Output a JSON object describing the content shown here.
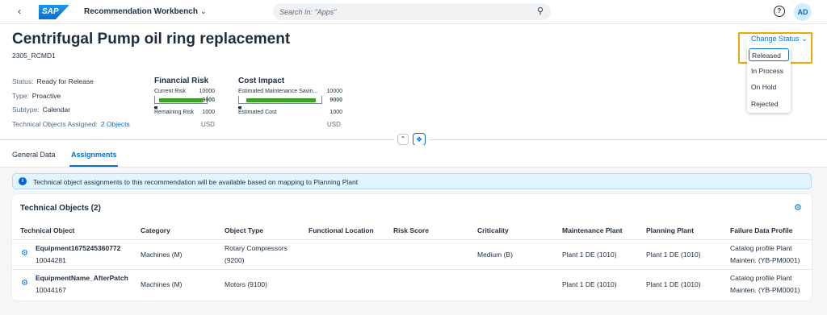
{
  "shell": {
    "logo_text": "SAP",
    "app_title": "Recommendation Workbench",
    "search_placeholder": "Search In: \"Apps\"",
    "user_initials": "AD"
  },
  "header": {
    "title": "Centrifugal Pump oil ring replacement",
    "subtitle": "2305_RCMD1",
    "status_label": "Status:",
    "status_value": "Ready for Release",
    "type_label": "Type:",
    "type_value": "Proactive",
    "subtype_label": "Subtype:",
    "subtype_value": "Calendar",
    "tech_objects_label": "Technical Objects Assigned:",
    "tech_objects_value": "2 Objects"
  },
  "financial_risk": {
    "title": "Financial Risk",
    "current_label": "Current Risk",
    "current_max": "10000",
    "current_value": "9000",
    "current_fraction": 0.9,
    "remaining_label": "Remaining Risk",
    "remaining_value": "1000",
    "unit": "USD"
  },
  "cost_impact": {
    "title": "Cost Impact",
    "savings_label": "Estimated Maintenance Savin...",
    "savings_max": "10000",
    "savings_value": "9000",
    "savings_fraction": 0.9,
    "cost_label": "Estimated Cost",
    "cost_value": "1000",
    "unit": "USD"
  },
  "change_status": {
    "label": "Change Status",
    "options": [
      "Released",
      "In Process",
      "On Hold",
      "Rejected"
    ],
    "highlight_color": "#e9a900"
  },
  "tabs": [
    "General Data",
    "Assignments"
  ],
  "info_message": "Technical object assignments to this recommendation will be available based on mapping to Planning Plant",
  "table": {
    "title": "Technical Objects (2)",
    "columns": [
      "Technical Object",
      "Category",
      "Object Type",
      "Functional Location",
      "Risk Score",
      "Criticality",
      "Maintenance Plant",
      "Planning Plant",
      "Failure Data Profile"
    ],
    "rows": [
      {
        "name": "Equipment1675245360772",
        "id": "10044281",
        "category": "Machines (M)",
        "object_type_1": "Rotary Compressors",
        "object_type_2": "(9200)",
        "criticality": "Medium (B)",
        "maintenance_plant": "Plant 1 DE (1010)",
        "planning_plant": "Plant 1 DE (1010)",
        "profile_1": "Catalog profile Plant",
        "profile_2": "Mainten. (YB-PM0001)"
      },
      {
        "name": "EquipmentName_AfterPatch",
        "id": "10044167",
        "category": "Machines (M)",
        "object_type_1": "Motors (9100)",
        "object_type_2": "",
        "criticality": "",
        "maintenance_plant": "Plant 1 DE (1010)",
        "planning_plant": "Plant 1 DE (1010)",
        "profile_1": "Catalog profile Plant",
        "profile_2": "Mainten. (YB-PM0001)"
      }
    ]
  },
  "colors": {
    "accent": "#0a6ed1",
    "bar_green": "#36a41d",
    "value_green": "#256f3a"
  }
}
